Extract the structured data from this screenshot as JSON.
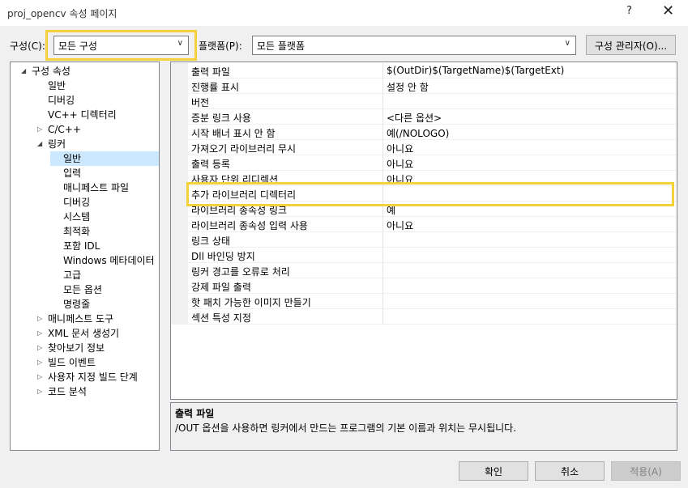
{
  "window": {
    "title": "proj_opencv 속성 페이지",
    "help": "?",
    "close": "✕"
  },
  "config": {
    "label": "구성(C):",
    "value": "모든 구성"
  },
  "platform": {
    "label": "플랫폼(P):",
    "value": "모든 플랫폼"
  },
  "config_manager": "구성 관리자(O)...",
  "tree": {
    "items": [
      {
        "label": "구성 속성",
        "arrow": "◢"
      },
      {
        "label": "일반",
        "arrow": ""
      },
      {
        "label": "디버깅",
        "arrow": ""
      },
      {
        "label": "VC++ 디렉터리",
        "arrow": ""
      },
      {
        "label": "C/C++",
        "arrow": "▷"
      },
      {
        "label": "링커",
        "arrow": "◢"
      },
      {
        "label": "일반",
        "arrow": ""
      },
      {
        "label": "입력",
        "arrow": ""
      },
      {
        "label": "매니페스트 파일",
        "arrow": ""
      },
      {
        "label": "디버깅",
        "arrow": ""
      },
      {
        "label": "시스템",
        "arrow": ""
      },
      {
        "label": "최적화",
        "arrow": ""
      },
      {
        "label": "포함 IDL",
        "arrow": ""
      },
      {
        "label": "Windows 메타데이터",
        "arrow": ""
      },
      {
        "label": "고급",
        "arrow": ""
      },
      {
        "label": "모든 옵션",
        "arrow": ""
      },
      {
        "label": "명령줄",
        "arrow": ""
      },
      {
        "label": "매니페스트 도구",
        "arrow": "▷"
      },
      {
        "label": "XML 문서 생성기",
        "arrow": "▷"
      },
      {
        "label": "찾아보기 정보",
        "arrow": "▷"
      },
      {
        "label": "빌드 이벤트",
        "arrow": "▷"
      },
      {
        "label": "사용자 지정 빌드 단계",
        "arrow": "▷"
      },
      {
        "label": "코드 분석",
        "arrow": "▷"
      }
    ]
  },
  "properties": [
    {
      "name": "출력 파일",
      "value": "$(OutDir)$(TargetName)$(TargetExt)"
    },
    {
      "name": "진행률 표시",
      "value": "설정 안 함"
    },
    {
      "name": "버전",
      "value": ""
    },
    {
      "name": "증분 링크 사용",
      "value": "<다른 옵션>"
    },
    {
      "name": "시작 배너 표시 안 함",
      "value": "예(/NOLOGO)"
    },
    {
      "name": "가져오기 라이브러리 무시",
      "value": "아니요"
    },
    {
      "name": "출력 등록",
      "value": "아니요"
    },
    {
      "name": "사용자 단위 리디렉션",
      "value": "아니요"
    },
    {
      "name": "추가 라이브러리 디렉터리",
      "value": ""
    },
    {
      "name": "라이브러리 종속성 링크",
      "value": "예"
    },
    {
      "name": "라이브러리 종속성 입력 사용",
      "value": "아니요"
    },
    {
      "name": "링크 상태",
      "value": ""
    },
    {
      "name": "Dll 바인딩 방지",
      "value": ""
    },
    {
      "name": "링커 경고를 오류로 처리",
      "value": ""
    },
    {
      "name": "강제 파일 출력",
      "value": ""
    },
    {
      "name": "핫 패치 가능한 이미지 만들기",
      "value": ""
    },
    {
      "name": "섹션 특성 지정",
      "value": ""
    }
  ],
  "description": {
    "title": "출력 파일",
    "text": "/OUT 옵션을 사용하면 링커에서 만드는 프로그램의 기본 이름과 위치는 무시됩니다."
  },
  "buttons": {
    "ok": "확인",
    "cancel": "취소",
    "apply": "적용(A)"
  },
  "colors": {
    "highlight": "#f5d23a",
    "selection": "#cce8ff"
  }
}
